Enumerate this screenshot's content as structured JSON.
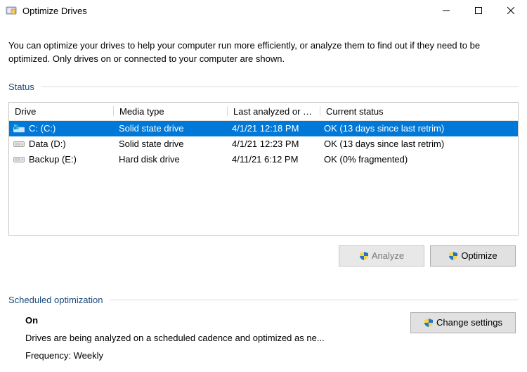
{
  "window": {
    "title": "Optimize Drives"
  },
  "intro": "You can optimize your drives to help your computer run more efficiently, or analyze them to find out if they need to be optimized. Only drives on or connected to your computer are shown.",
  "sections": {
    "status_label": "Status",
    "sched_label": "Scheduled optimization"
  },
  "grid": {
    "headers": {
      "drive": "Drive",
      "media": "Media type",
      "last": "Last analyzed or o...",
      "status": "Current status"
    },
    "rows": [
      {
        "drive": "C: (C:)",
        "media": "Solid state drive",
        "last": "4/1/21 12:18 PM",
        "status": "OK (13 days since last retrim)",
        "selected": true,
        "kind": "os"
      },
      {
        "drive": "Data (D:)",
        "media": "Solid state drive",
        "last": "4/1/21 12:23 PM",
        "status": "OK (13 days since last retrim)",
        "selected": false,
        "kind": "ssd"
      },
      {
        "drive": "Backup (E:)",
        "media": "Hard disk drive",
        "last": "4/11/21 6:12 PM",
        "status": "OK (0% fragmented)",
        "selected": false,
        "kind": "hdd"
      }
    ]
  },
  "buttons": {
    "analyze": "Analyze",
    "optimize": "Optimize",
    "change_settings": "Change settings"
  },
  "schedule": {
    "state": "On",
    "desc": "Drives are being analyzed on a scheduled cadence and optimized as ne...",
    "freq": "Frequency: Weekly"
  }
}
